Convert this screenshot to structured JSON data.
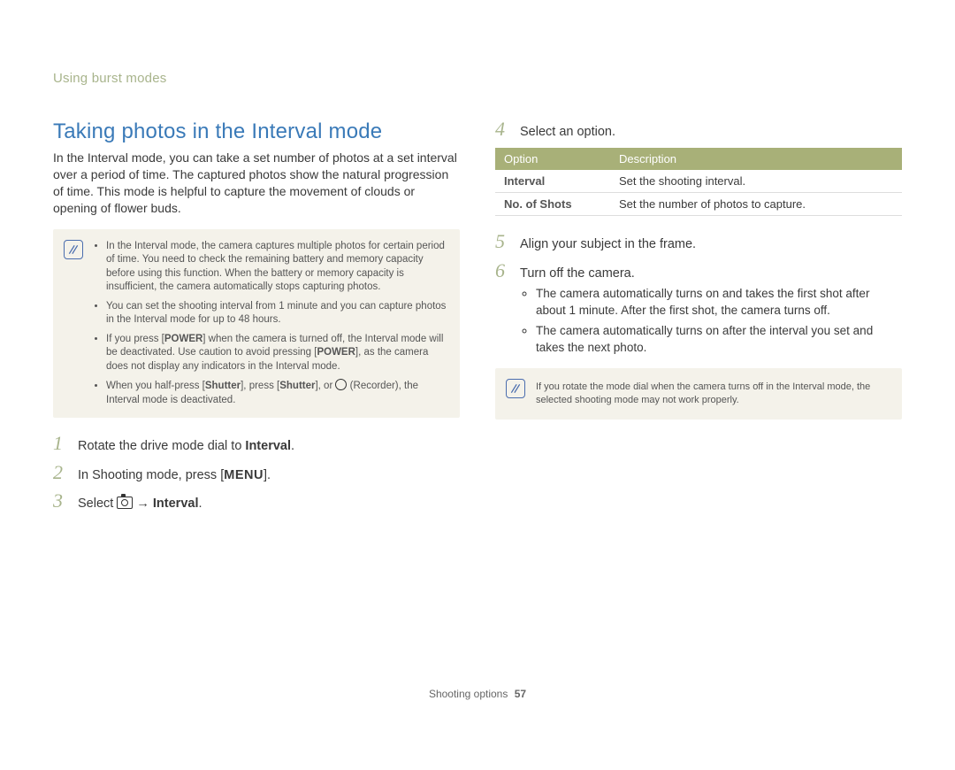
{
  "breadcrumb": "Using burst modes",
  "heading": "Taking photos in the Interval mode",
  "intro": "In the Interval mode, you can take a set number of photos at a set interval over a period of time. The captured photos show the natural progression of time. This mode is helpful to capture the movement of clouds or opening of flower buds.",
  "note1": {
    "items": [
      "In the Interval mode, the camera captures multiple photos for certain period of time. You need to check the remaining battery and memory capacity before using this function. When the battery or memory capacity is insufficient, the camera automatically stops capturing photos.",
      "You can set the shooting interval from 1 minute and you can capture photos in the Interval mode for up to 48 hours.",
      "If you press [POWER] when the camera is turned off, the Interval mode will be deactivated. Use caution to avoid pressing [POWER], as the camera does not display any indicators in the Interval mode.",
      "When you half-press [Shutter], press [Shutter], or ○ (Recorder), the Interval mode is deactivated."
    ]
  },
  "steps_left": [
    {
      "n": "1",
      "text_a": "Rotate the drive mode dial to ",
      "bold": "Interval",
      "text_b": "."
    },
    {
      "n": "2",
      "text_a": "In Shooting mode, press [",
      "menu": "MENU",
      "text_b": "]."
    },
    {
      "n": "3",
      "text_a": "Select ",
      "icon": "camera",
      "arrow": " → ",
      "bold": "Interval",
      "text_b": "."
    }
  ],
  "steps_right": [
    {
      "n": "4",
      "text": "Select an option."
    },
    {
      "n": "5",
      "text": "Align your subject in the frame."
    },
    {
      "n": "6",
      "text": "Turn off the camera."
    }
  ],
  "options_table": {
    "headers": [
      "Option",
      "Description"
    ],
    "rows": [
      [
        "Interval",
        "Set the shooting interval."
      ],
      [
        "No. of Shots",
        "Set the number of photos to capture."
      ]
    ]
  },
  "sub6": [
    "The camera automatically turns on and takes the first shot after about 1 minute. After the first shot, the camera turns off.",
    "The camera automatically turns on after the interval you set and takes the next photo."
  ],
  "note2": "If you rotate the mode dial when the camera turns off in the Interval mode, the selected shooting mode may not work properly.",
  "footer": {
    "section": "Shooting options",
    "page": "57"
  }
}
